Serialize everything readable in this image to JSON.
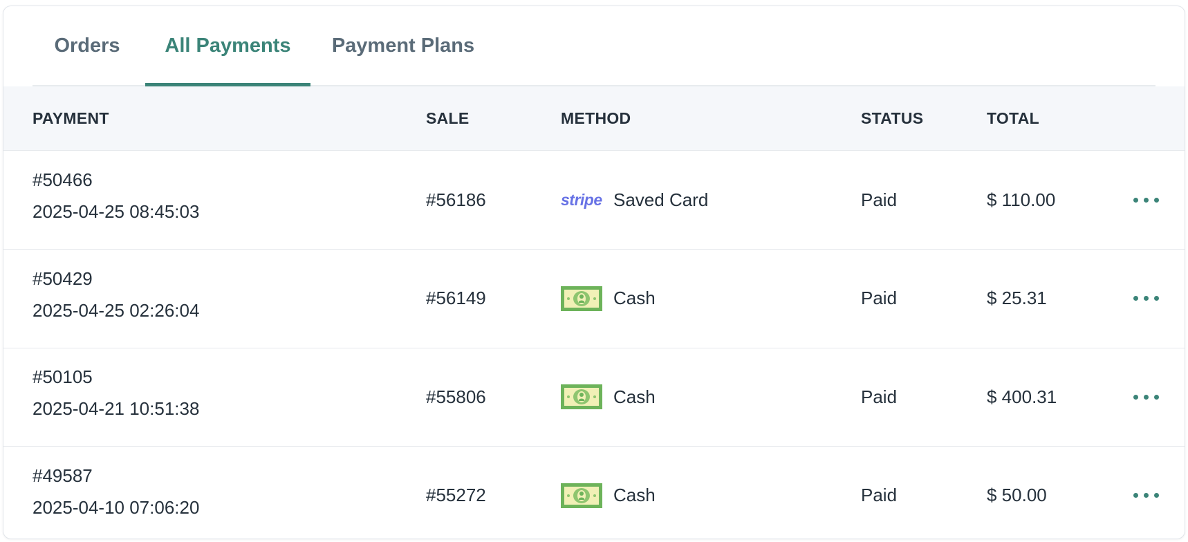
{
  "tabs": [
    {
      "label": "Orders",
      "active": false
    },
    {
      "label": "All Payments",
      "active": true
    },
    {
      "label": "Payment Plans",
      "active": false
    }
  ],
  "columns": {
    "payment": "PAYMENT",
    "sale": "SALE",
    "method": "METHOD",
    "status": "STATUS",
    "total": "TOTAL"
  },
  "colors": {
    "accent": "#3b8478",
    "stripe": "#6772e5",
    "cash_green": "#6db35a",
    "cash_light": "#f1f0b6"
  },
  "rows": [
    {
      "payment_id": "#50466",
      "date": "2025-04-25 08:45:03",
      "sale": "#56186",
      "method_icon": "stripe-logo",
      "method_logo_text": "stripe",
      "method": "Saved Card",
      "status": "Paid",
      "total": "$ 110.00"
    },
    {
      "payment_id": "#50429",
      "date": "2025-04-25 02:26:04",
      "sale": "#56149",
      "method_icon": "cash-icon",
      "method": "Cash",
      "status": "Paid",
      "total": "$ 25.31"
    },
    {
      "payment_id": "#50105",
      "date": "2025-04-21 10:51:38",
      "sale": "#55806",
      "method_icon": "cash-icon",
      "method": "Cash",
      "status": "Paid",
      "total": "$ 400.31"
    },
    {
      "payment_id": "#49587",
      "date": "2025-04-10 07:06:20",
      "sale": "#55272",
      "method_icon": "cash-icon",
      "method": "Cash",
      "status": "Paid",
      "total": "$ 50.00"
    }
  ]
}
